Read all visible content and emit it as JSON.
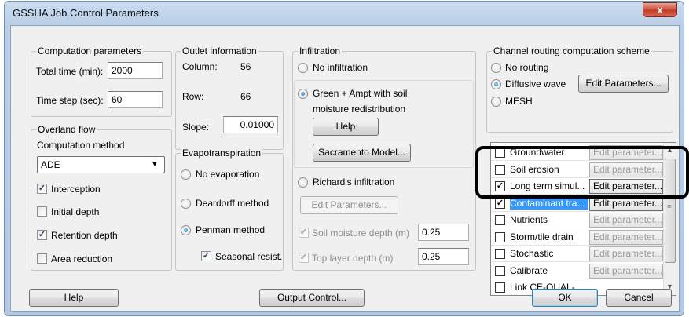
{
  "window": {
    "title": "GSSHA Job Control Parameters",
    "close_glyph": "x"
  },
  "computation": {
    "legend": "Computation parameters",
    "total_time_label": "Total time (min):",
    "total_time_value": "2000",
    "time_step_label": "Time step (sec):",
    "time_step_value": "60"
  },
  "outlet": {
    "legend": "Outlet information",
    "column_label": "Column:",
    "column_value": "56",
    "row_label": "Row:",
    "row_value": "66",
    "slope_label": "Slope:",
    "slope_value": "0.01000"
  },
  "overland": {
    "legend": "Overland flow",
    "method_label": "Computation method",
    "method_value": "ADE",
    "checks": [
      {
        "label": "Interception",
        "checked": true
      },
      {
        "label": "Initial depth",
        "checked": false
      },
      {
        "label": "Retention depth",
        "checked": true
      },
      {
        "label": "Area reduction",
        "checked": false
      }
    ]
  },
  "evapo": {
    "legend": "Evapotranspiration",
    "options": [
      {
        "label": "No evaporation",
        "selected": false
      },
      {
        "label": "Deardorff method",
        "selected": false
      },
      {
        "label": "Penman method",
        "selected": true
      }
    ],
    "seasonal_label": "Seasonal resist.",
    "seasonal_checked": true
  },
  "infiltration": {
    "legend": "Infiltration",
    "no_infiltration": "No infiltration",
    "green_ampt_line1": "Green + Ampt with soil",
    "green_ampt_line2": "moisture redistribution",
    "help_button": "Help",
    "sacramento_button": "Sacramento Model...",
    "richards": "Richard's infiltration",
    "edit_parameters_button": "Edit Parameters...",
    "soil_moisture_label": "Soil moisture depth (m)",
    "soil_moisture_value": "0.25",
    "top_layer_label": "Top layer depth (m)",
    "top_layer_value": "0.25"
  },
  "channel": {
    "legend": "Channel routing computation scheme",
    "options": [
      {
        "label": "No routing",
        "selected": false
      },
      {
        "label": "Diffusive wave",
        "selected": true
      },
      {
        "label": "MESH",
        "selected": false
      }
    ],
    "edit_button": "Edit Parameters..."
  },
  "options_list": [
    {
      "name": "Groundwater",
      "checked": false,
      "button": "Edit parameter...",
      "active": false,
      "selected": false
    },
    {
      "name": "Soil erosion",
      "checked": false,
      "button": "Edit parameter...",
      "active": false,
      "selected": false
    },
    {
      "name": "Long term simul...",
      "checked": true,
      "button": "Edit parameter...",
      "active": true,
      "selected": false
    },
    {
      "name": "Contaminant tra...",
      "checked": true,
      "button": "Edit parameter...",
      "active": true,
      "selected": true
    },
    {
      "name": "Nutrients",
      "checked": false,
      "button": "Edit parameter...",
      "active": false,
      "selected": false
    },
    {
      "name": "Storm/tile drain",
      "checked": false,
      "button": "Edit parameter...",
      "active": false,
      "selected": false
    },
    {
      "name": "Stochastic",
      "checked": false,
      "button": "Edit parameter...",
      "active": false,
      "selected": false
    },
    {
      "name": "Calibrate",
      "checked": false,
      "button": "Edit parameter...",
      "active": false,
      "selected": false
    },
    {
      "name": "Link CE-QUAL-...",
      "checked": false,
      "button": "",
      "active": false,
      "selected": false
    }
  ],
  "footer": {
    "help": "Help",
    "output_control": "Output Control...",
    "ok": "OK",
    "cancel": "Cancel"
  },
  "icons": {
    "check": "✓",
    "dropdown": "▼",
    "scroll_up": "▲",
    "scroll_down": "▼",
    "grip": "≡"
  }
}
